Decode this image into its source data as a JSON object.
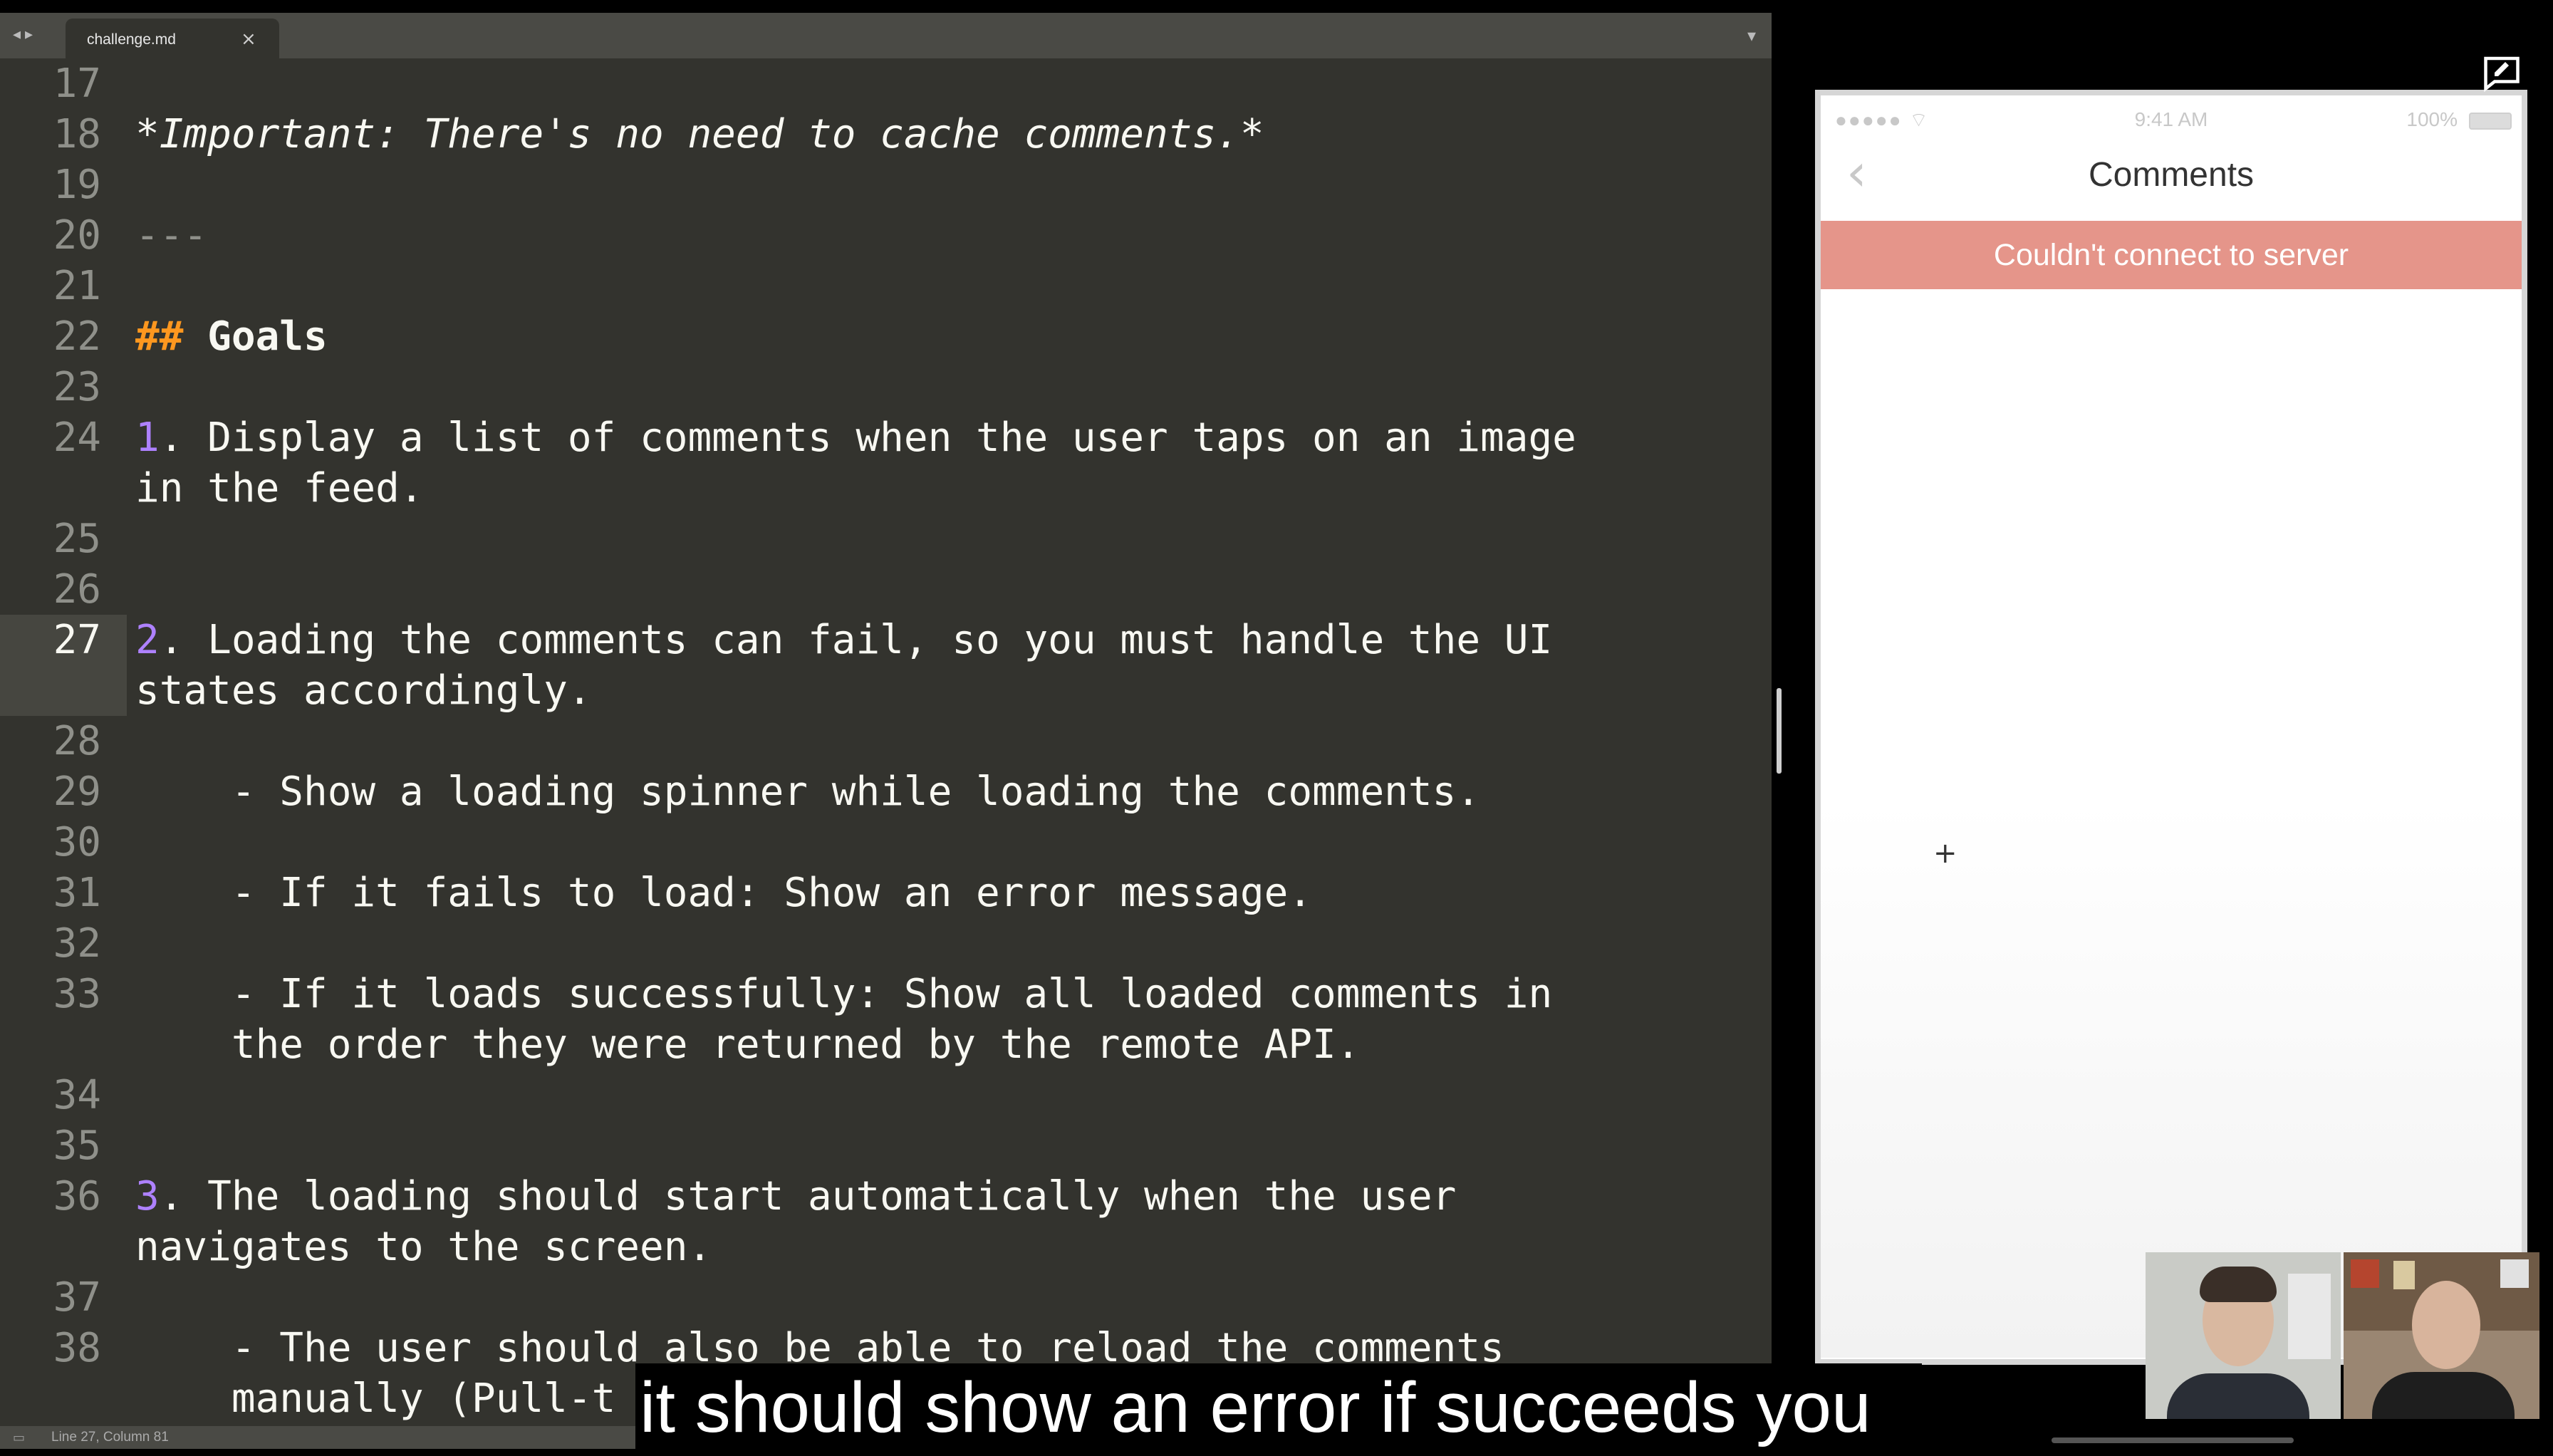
{
  "editor": {
    "tab_label": "challenge.md",
    "tab_close": "×",
    "tab_nav": "◂▸",
    "tab_menu": "▾",
    "status": "Line 27, Column 81",
    "lines": [
      {
        "n": "17",
        "t": ""
      },
      {
        "n": "18",
        "t": "*Important: There's no need to cache comments.*"
      },
      {
        "n": "19",
        "t": ""
      },
      {
        "n": "20",
        "t": "---"
      },
      {
        "n": "21",
        "t": ""
      },
      {
        "n": "22",
        "hash": "##",
        "t": "Goals"
      },
      {
        "n": "23",
        "t": ""
      },
      {
        "n": "24",
        "num": "1",
        "t": ". Display a list of comments when the user taps on an image",
        "t2": "in the feed."
      },
      {
        "n": "25",
        "t": ""
      },
      {
        "n": "26",
        "t": ""
      },
      {
        "n": "27",
        "num": "2",
        "t": ". Loading the comments can fail, so you must handle the UI",
        "t2": "states accordingly."
      },
      {
        "n": "28",
        "t": ""
      },
      {
        "n": "29",
        "t": "    - Show a loading spinner while loading the comments."
      },
      {
        "n": "30",
        "t": ""
      },
      {
        "n": "31",
        "t": "    - If it fails to load: Show an error message."
      },
      {
        "n": "32",
        "t": ""
      },
      {
        "n": "33",
        "t": "    - If it loads successfully: Show all loaded comments in",
        "t2": "    the order they were returned by the remote API."
      },
      {
        "n": "34",
        "t": ""
      },
      {
        "n": "35",
        "t": ""
      },
      {
        "n": "36",
        "num": "3",
        "t": ". The loading should start automatically when the user",
        "t2": "navigates to the screen."
      },
      {
        "n": "37",
        "t": ""
      },
      {
        "n": "38",
        "t": "    - The user should also be able to reload the comments",
        "t2": "    manually (Pull-t"
      }
    ]
  },
  "simulator": {
    "signal": "●●●●● ",
    "time": "9:41 AM",
    "battery": "100%",
    "back": "‹",
    "title": "Comments",
    "error": "Couldn't connect to server",
    "crosshair": "+"
  },
  "caption": "it should show an error if succeeds you",
  "colors": {
    "editor_bg": "#33332e",
    "error_banner": "#e5958a",
    "numbering": "#ae81ff",
    "heading_hash": "#fd971f"
  }
}
